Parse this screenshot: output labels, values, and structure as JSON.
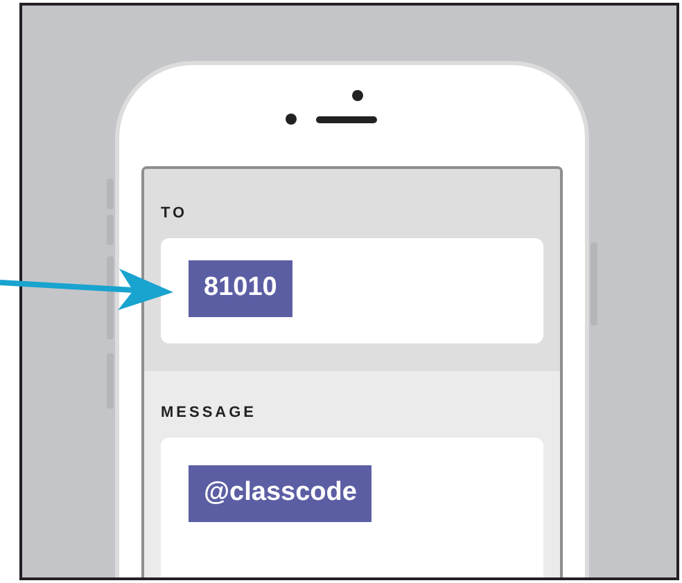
{
  "to": {
    "label": "TO",
    "value": "81010"
  },
  "message": {
    "label": "MESSAGE",
    "value": "@classcode"
  }
}
